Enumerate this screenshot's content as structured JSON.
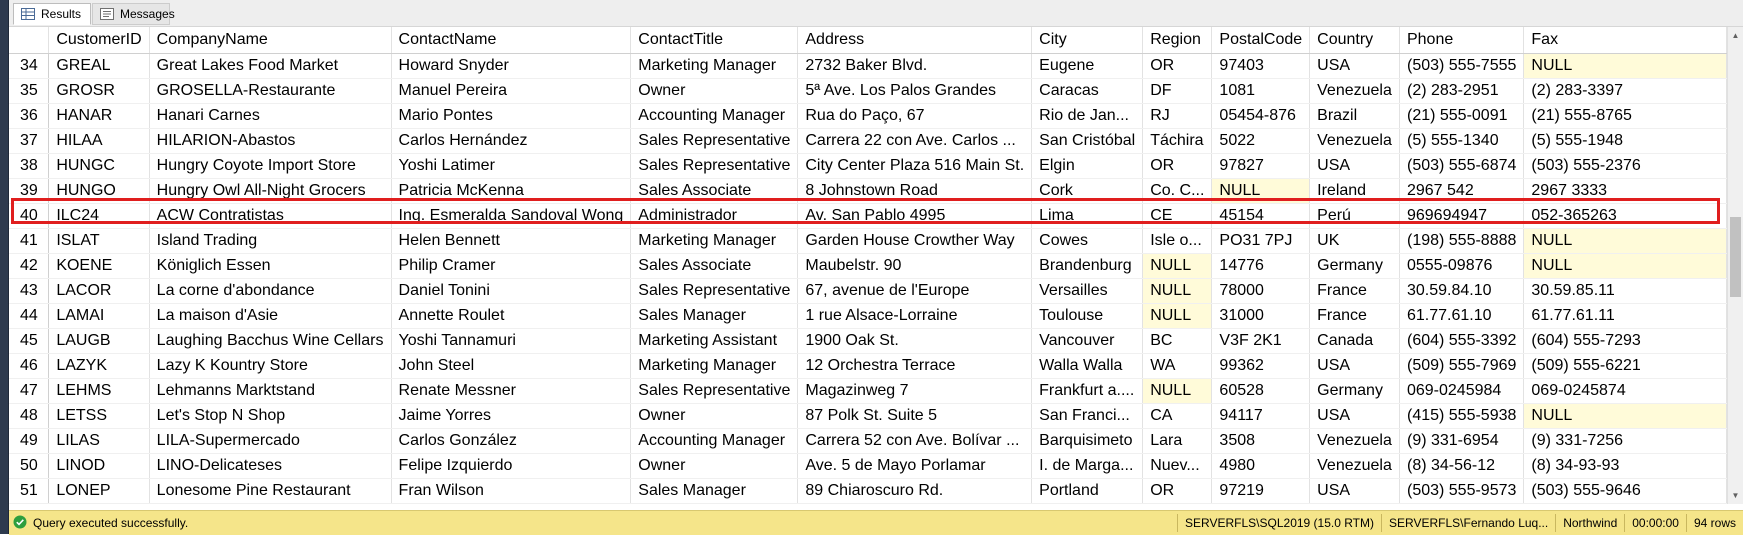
{
  "tabs": [
    {
      "label": "Results",
      "icon": "grid-icon"
    },
    {
      "label": "Messages",
      "icon": "messages-icon"
    }
  ],
  "columns": [
    "",
    "CustomerID",
    "CompanyName",
    "ContactName",
    "ContactTitle",
    "Address",
    "City",
    "Region",
    "PostalCode",
    "Country",
    "Phone",
    "Fax"
  ],
  "rows": [
    [
      "34",
      "GREAL",
      "Great Lakes Food Market",
      "Howard Snyder",
      "Marketing Manager",
      "2732 Baker Blvd.",
      "Eugene",
      "OR",
      "97403",
      "USA",
      "(503) 555-7555",
      "NULL"
    ],
    [
      "35",
      "GROSR",
      "GROSELLA-Restaurante",
      "Manuel Pereira",
      "Owner",
      "5ª Ave. Los Palos Grandes",
      "Caracas",
      "DF",
      "1081",
      "Venezuela",
      "(2) 283-2951",
      "(2) 283-3397"
    ],
    [
      "36",
      "HANAR",
      "Hanari Carnes",
      "Mario Pontes",
      "Accounting Manager",
      "Rua do Paço, 67",
      "Rio de Jan...",
      "RJ",
      "05454-876",
      "Brazil",
      "(21) 555-0091",
      "(21) 555-8765"
    ],
    [
      "37",
      "HILAA",
      "HILARION-Abastos",
      "Carlos Hernández",
      "Sales Representative",
      "Carrera 22 con Ave. Carlos ...",
      "San Cristóbal",
      "Táchira",
      "5022",
      "Venezuela",
      "(5) 555-1340",
      "(5) 555-1948"
    ],
    [
      "38",
      "HUNGC",
      "Hungry Coyote Import Store",
      "Yoshi Latimer",
      "Sales Representative",
      "City Center Plaza 516 Main St.",
      "Elgin",
      "OR",
      "97827",
      "USA",
      "(503) 555-6874",
      "(503) 555-2376"
    ],
    [
      "39",
      "HUNGO",
      "Hungry Owl All-Night Grocers",
      "Patricia McKenna",
      "Sales Associate",
      "8 Johnstown Road",
      "Cork",
      "Co. C...",
      "NULL",
      "Ireland",
      "2967 542",
      "2967 3333"
    ],
    [
      "40",
      "ILC24",
      "ACW Contratistas",
      "Ing. Esmeralda Sandoval Wong",
      "Administrador",
      "Av. San Pablo 4995",
      "Lima",
      "CE",
      "45154",
      "Perú",
      "969694947",
      "052-365263"
    ],
    [
      "41",
      "ISLAT",
      "Island Trading",
      "Helen Bennett",
      "Marketing Manager",
      "Garden House Crowther Way",
      "Cowes",
      "Isle o...",
      "PO31 7PJ",
      "UK",
      "(198) 555-8888",
      "NULL"
    ],
    [
      "42",
      "KOENE",
      "Königlich Essen",
      "Philip Cramer",
      "Sales Associate",
      "Maubelstr. 90",
      "Brandenburg",
      "NULL",
      "14776",
      "Germany",
      "0555-09876",
      "NULL"
    ],
    [
      "43",
      "LACOR",
      "La corne d'abondance",
      "Daniel Tonini",
      "Sales Representative",
      "67, avenue de l'Europe",
      "Versailles",
      "NULL",
      "78000",
      "France",
      "30.59.84.10",
      "30.59.85.11"
    ],
    [
      "44",
      "LAMAI",
      "La maison d'Asie",
      "Annette Roulet",
      "Sales Manager",
      "1 rue Alsace-Lorraine",
      "Toulouse",
      "NULL",
      "31000",
      "France",
      "61.77.61.10",
      "61.77.61.11"
    ],
    [
      "45",
      "LAUGB",
      "Laughing Bacchus Wine Cellars",
      "Yoshi Tannamuri",
      "Marketing Assistant",
      "1900 Oak St.",
      "Vancouver",
      "BC",
      "V3F 2K1",
      "Canada",
      "(604) 555-3392",
      "(604) 555-7293"
    ],
    [
      "46",
      "LAZYK",
      "Lazy K Kountry Store",
      "John Steel",
      "Marketing Manager",
      "12 Orchestra Terrace",
      "Walla Walla",
      "WA",
      "99362",
      "USA",
      "(509) 555-7969",
      "(509) 555-6221"
    ],
    [
      "47",
      "LEHMS",
      "Lehmanns Marktstand",
      "Renate Messner",
      "Sales Representative",
      "Magazinweg 7",
      "Frankfurt a....",
      "NULL",
      "60528",
      "Germany",
      "069-0245984",
      "069-0245874"
    ],
    [
      "48",
      "LETSS",
      "Let's Stop N Shop",
      "Jaime Yorres",
      "Owner",
      "87 Polk St. Suite 5",
      "San Franci...",
      "CA",
      "94117",
      "USA",
      "(415) 555-5938",
      "NULL"
    ],
    [
      "49",
      "LILAS",
      "LILA-Supermercado",
      "Carlos González",
      "Accounting Manager",
      "Carrera 52 con Ave. Bolívar ...",
      "Barquisimeto",
      "Lara",
      "3508",
      "Venezuela",
      "(9) 331-6954",
      "(9) 331-7256"
    ],
    [
      "50",
      "LINOD",
      "LINO-Delicateses",
      "Felipe Izquierdo",
      "Owner",
      "Ave. 5 de Mayo Porlamar",
      "I. de Marga...",
      "Nuev...",
      "4980",
      "Venezuela",
      "(8) 34-56-12",
      "(8) 34-93-93"
    ],
    [
      "51",
      "LONEP",
      "Lonesome Pine Restaurant",
      "Fran Wilson",
      "Sales Manager",
      "89 Chiaroscuro Rd.",
      "Portland",
      "OR",
      "97219",
      "USA",
      "(503) 555-9573",
      "(503) 555-9646"
    ]
  ],
  "highlighted_row": "40",
  "null_value": "NULL",
  "status": {
    "message": "Query executed successfully.",
    "server": "SERVERFLS\\SQL2019 (15.0 RTM)",
    "user": "SERVERFLS\\Fernando Luq...",
    "database": "Northwind",
    "elapsed": "00:00:00",
    "rows": "94 rows"
  },
  "colors": {
    "highlight_border": "#e01e1e",
    "null_cell_bg": "#fffbd9",
    "status_bar_bg": "#f5e58a",
    "status_ok": "#2e9e3e"
  }
}
